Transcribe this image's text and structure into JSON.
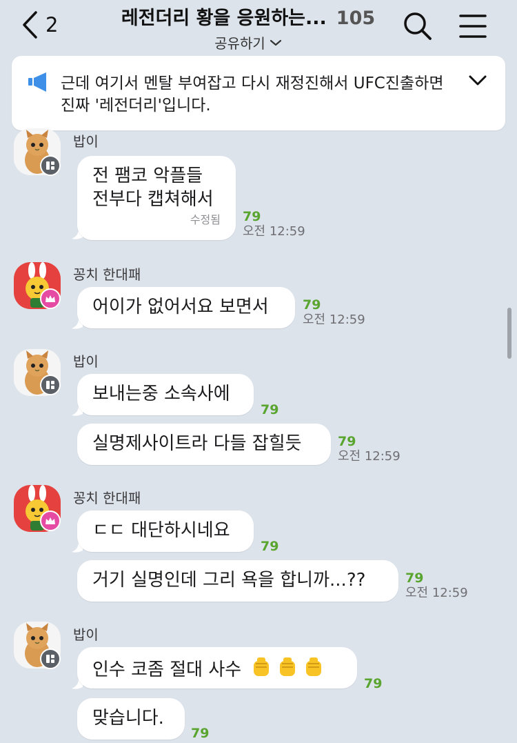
{
  "header": {
    "back_count": "2",
    "title": "레전더리 황을 응원하는...",
    "member_count": "105",
    "share_label": "공유하기"
  },
  "notice": {
    "text": "근데 여기서 멘탈 부여잡고 다시 재정진해서 UFC진출하면 진짜 '레전더리'입니다."
  },
  "messages": [
    {
      "sender": "밥이",
      "text_lines": [
        "전 팸코 악플들",
        "전부다 캡쳐해서"
      ],
      "edited": "수정됨",
      "count": "79",
      "time": "오전 12:59"
    },
    {
      "sender": "꽁치 한대패",
      "text": "어이가 없어서요 보면서",
      "count": "79",
      "time": "오전 12:59"
    },
    {
      "sender": "밥이",
      "text": "보내는중 소속사에",
      "count": "79"
    },
    {
      "text": "실명제사이트라 다들 잡힐듯",
      "count": "79",
      "time": "오전 12:59"
    },
    {
      "sender": "꽁치 한대패",
      "text": "ㄷㄷ 대단하시네요",
      "count": "79"
    },
    {
      "text": "거기 실명인데 그리 욕을 합니까...??",
      "count": "79",
      "time": "오전 12:59"
    },
    {
      "sender": "밥이",
      "text": "인수 코좀 절대 사수",
      "emojis": [
        "raised-fist",
        "raised-fist",
        "raised-fist"
      ],
      "count": "79"
    },
    {
      "text": "맞습니다.",
      "count": "79"
    }
  ],
  "icons": {
    "back": "chevron-left-icon",
    "share": "chevron-down-icon",
    "search": "search-icon",
    "menu": "hamburger-menu-icon",
    "notice": "megaphone-icon",
    "notice_expand": "chevron-down-icon"
  },
  "colors": {
    "background": "#dde3eb",
    "bubble": "#ffffff",
    "read_count": "#59a52f",
    "notice_icon": "#3d8fe8",
    "owner_badge": "#e64ba4",
    "manager_badge": "#5b5f66"
  }
}
